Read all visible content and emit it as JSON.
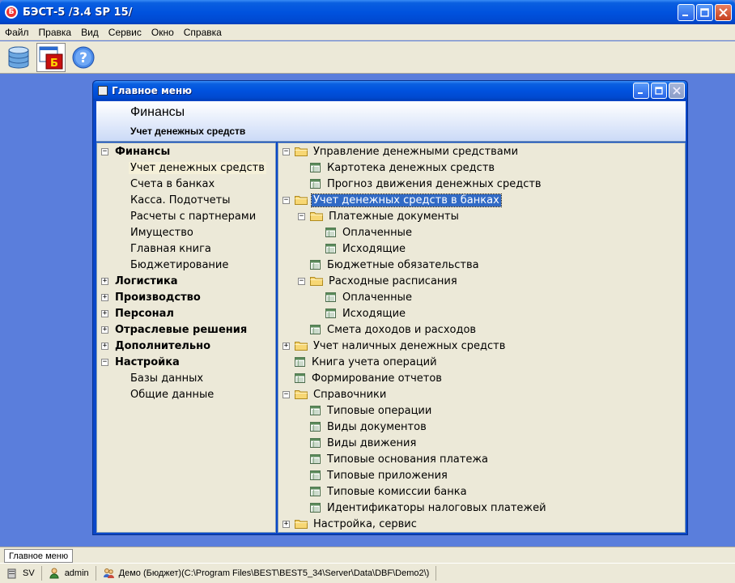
{
  "app": {
    "title": "БЭСТ-5 /3.4 SP 15/",
    "icon_letter": "Б"
  },
  "menu": [
    "Файл",
    "Правка",
    "Вид",
    "Сервис",
    "Окно",
    "Справка"
  ],
  "toolbar": {
    "icons": [
      "database-icon",
      "best-app-icon",
      "help-icon"
    ],
    "help_glyph": "?"
  },
  "window": {
    "title": "Главное меню",
    "header": {
      "title": "Финансы",
      "subtitle": "Учет денежных средств"
    }
  },
  "left_tree": [
    {
      "label": "Финансы",
      "level": 0,
      "expander": "−",
      "bold": true
    },
    {
      "label": "Учет денежных средств",
      "level": 1,
      "selected": true
    },
    {
      "label": "Счета в банках",
      "level": 1
    },
    {
      "label": "Касса. Подотчеты",
      "level": 1
    },
    {
      "label": "Расчеты с партнерами",
      "level": 1
    },
    {
      "label": "Имущество",
      "level": 1
    },
    {
      "label": "Главная книга",
      "level": 1
    },
    {
      "label": "Бюджетирование",
      "level": 1
    },
    {
      "label": "Логистика",
      "level": 0,
      "expander": "+",
      "bold": true
    },
    {
      "label": "Производство",
      "level": 0,
      "expander": "+",
      "bold": true
    },
    {
      "label": "Персонал",
      "level": 0,
      "expander": "+",
      "bold": true
    },
    {
      "label": "Отраслевые решения",
      "level": 0,
      "expander": "+",
      "bold": true
    },
    {
      "label": "Дополнительно",
      "level": 0,
      "expander": "+",
      "bold": true
    },
    {
      "label": "Настройка",
      "level": 0,
      "expander": "−",
      "bold": true
    },
    {
      "label": "Базы данных",
      "level": 1
    },
    {
      "label": "Общие данные",
      "level": 1
    }
  ],
  "right_tree": [
    {
      "label": "Управление денежными средствами",
      "level": 0,
      "expander": "−",
      "icon": "folder"
    },
    {
      "label": "Картотека денежных средств",
      "level": 1,
      "icon": "doc"
    },
    {
      "label": "Прогноз движения денежных средств",
      "level": 1,
      "icon": "doc"
    },
    {
      "label": "Учет денежных средств в банках",
      "level": 0,
      "expander": "−",
      "icon": "folder",
      "highlighted": true
    },
    {
      "label": "Платежные документы",
      "level": 1,
      "expander": "−",
      "icon": "folder"
    },
    {
      "label": "Оплаченные",
      "level": 2,
      "icon": "doc"
    },
    {
      "label": "Исходящие",
      "level": 2,
      "icon": "doc"
    },
    {
      "label": "Бюджетные обязательства",
      "level": 1,
      "icon": "doc"
    },
    {
      "label": "Расходные расписания",
      "level": 1,
      "expander": "−",
      "icon": "folder"
    },
    {
      "label": "Оплаченные",
      "level": 2,
      "icon": "doc"
    },
    {
      "label": "Исходящие",
      "level": 2,
      "icon": "doc"
    },
    {
      "label": "Смета доходов и расходов",
      "level": 1,
      "icon": "doc"
    },
    {
      "label": "Учет наличных денежных средств",
      "level": 0,
      "expander": "+",
      "icon": "folder"
    },
    {
      "label": "Книга учета операций",
      "level": 0,
      "icon": "doc"
    },
    {
      "label": "Формирование отчетов",
      "level": 0,
      "icon": "doc"
    },
    {
      "label": "Справочники",
      "level": 0,
      "expander": "−",
      "icon": "folder"
    },
    {
      "label": "Типовые операции",
      "level": 1,
      "icon": "doc"
    },
    {
      "label": "Виды документов",
      "level": 1,
      "icon": "doc"
    },
    {
      "label": "Виды движения",
      "level": 1,
      "icon": "doc"
    },
    {
      "label": "Типовые основания платежа",
      "level": 1,
      "icon": "doc"
    },
    {
      "label": "Типовые приложения",
      "level": 1,
      "icon": "doc"
    },
    {
      "label": "Типовые комиссии банка",
      "level": 1,
      "icon": "doc"
    },
    {
      "label": "Идентификаторы налоговых платежей",
      "level": 1,
      "icon": "doc"
    },
    {
      "label": "Настройка, сервис",
      "level": 0,
      "expander": "+",
      "icon": "folder"
    }
  ],
  "status": {
    "window_tab": "Главное меню",
    "server": "SV",
    "user": "admin",
    "database": "Демо (Бюджет)(C:\\Program Files\\BEST\\BEST5_34\\Server\\Data\\DBF\\Demo2\\)"
  }
}
